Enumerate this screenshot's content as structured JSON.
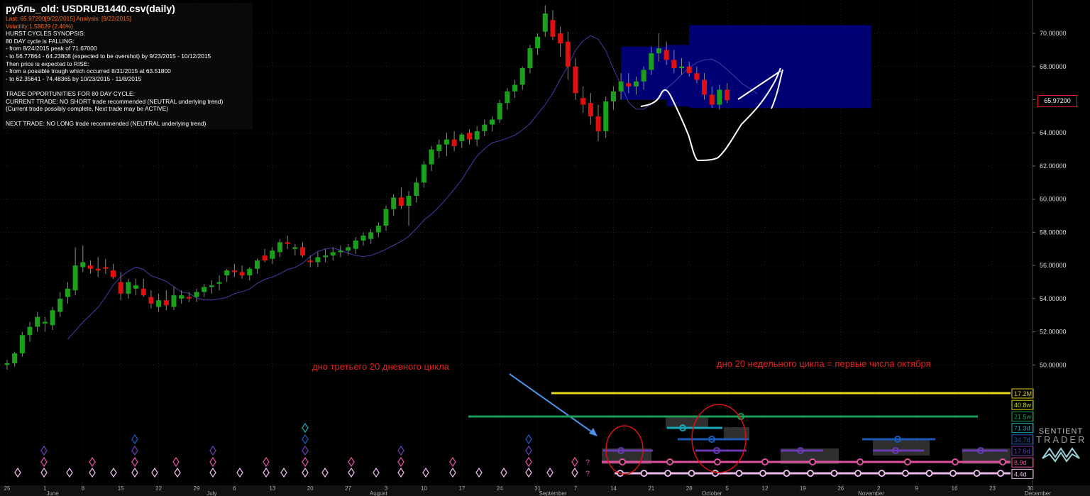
{
  "info": {
    "title": "рубль_old: USDRUB1440.csv(daily)",
    "last": "Last: 65.97200[9/22/2015] Analysis: [9/22/2015]",
    "volatility": "Volatility:1.58629 (2.40%)",
    "lines": [
      "HURST CYCLES SYNOPSIS:",
      "80 DAY cycle is FALLING:",
      "- from 8/24/2015 peak of 71.67000",
      "- to 56.77864 - 64.23808 (expected to be overshot) by 9/23/2015 - 10/12/2015",
      "Then price is expected to RISE:",
      "- from a possible trough which occurred 8/31/2015 at 63.51800",
      "- to 62.35641 - 74.48365 by 10/23/2015 - 11/8/2015",
      "",
      "TRADE OPPORTUNITIES FOR 80 DAY CYCLE:",
      "CURRENT TRADE: NO SHORT trade recommended (NEUTRAL underlying trend)",
      "(Current trade possibly complete, Next trade may be ACTIVE)",
      "",
      "NEXT TRADE: NO LONG trade recommended (NEUTRAL underlying trend)"
    ]
  },
  "current_price": "65.97200",
  "annotations": {
    "left": "дно третьего 20 дневного цикла",
    "right": "дно 20 недельного цикла = первые числа октября"
  },
  "logo": {
    "line1": "SENTIENT",
    "line2": "TRADER"
  },
  "colors": {
    "up": "#1aa01a",
    "down": "#e01010",
    "background": "#000000",
    "projection": "#00008a"
  },
  "chart_data": {
    "type": "candlestick",
    "y_ticks": [
      "50.00000",
      "52.00000",
      "54.00000",
      "56.00000",
      "58.00000",
      "60.00000",
      "62.00000",
      "64.00000",
      "66.00000",
      "68.00000",
      "70.00000"
    ],
    "ylim": [
      48.9,
      71.8
    ],
    "x_tick_labels": [
      {
        "day": 0,
        "label": "25"
      },
      {
        "day": 5,
        "label": "1"
      },
      {
        "day": 10,
        "label": "8"
      },
      {
        "day": 15,
        "label": "15"
      },
      {
        "day": 20,
        "label": "22"
      },
      {
        "day": 25,
        "label": "29"
      },
      {
        "day": 30,
        "label": "6"
      },
      {
        "day": 35,
        "label": "13"
      },
      {
        "day": 40,
        "label": "20"
      },
      {
        "day": 45,
        "label": "27"
      },
      {
        "day": 50,
        "label": "3"
      },
      {
        "day": 55,
        "label": "10"
      },
      {
        "day": 60,
        "label": "17"
      },
      {
        "day": 65,
        "label": "24"
      },
      {
        "day": 70,
        "label": "31"
      },
      {
        "day": 75,
        "label": "7"
      },
      {
        "day": 80,
        "label": "14"
      },
      {
        "day": 85,
        "label": "21"
      },
      {
        "day": 90,
        "label": "28"
      },
      {
        "day": 95,
        "label": "5"
      },
      {
        "day": 100,
        "label": "12"
      },
      {
        "day": 105,
        "label": "19"
      },
      {
        "day": 110,
        "label": "26"
      },
      {
        "day": 115,
        "label": "2"
      },
      {
        "day": 120,
        "label": "9"
      },
      {
        "day": 125,
        "label": "16"
      },
      {
        "day": 130,
        "label": "23"
      },
      {
        "day": 135,
        "label": "30"
      }
    ],
    "month_labels": [
      {
        "day": 6,
        "label": "June"
      },
      {
        "day": 27,
        "label": "July"
      },
      {
        "day": 49,
        "label": "August"
      },
      {
        "day": 72,
        "label": "September"
      },
      {
        "day": 93,
        "label": "October"
      },
      {
        "day": 114,
        "label": "November"
      },
      {
        "day": 136,
        "label": "December"
      }
    ],
    "candles": [
      [
        50.0,
        50.3,
        49.7,
        50.1
      ],
      [
        50.1,
        50.8,
        49.9,
        50.7
      ],
      [
        50.7,
        52.0,
        50.5,
        51.8
      ],
      [
        51.8,
        52.6,
        51.4,
        52.3
      ],
      [
        52.3,
        53.2,
        52.0,
        52.9
      ],
      [
        52.5,
        52.9,
        52.0,
        52.6
      ],
      [
        52.4,
        53.5,
        52.1,
        53.3
      ],
      [
        53.2,
        54.4,
        52.9,
        54.0
      ],
      [
        54.1,
        55.0,
        53.7,
        54.6
      ],
      [
        54.5,
        57.1,
        54.2,
        56.0
      ],
      [
        55.9,
        57.2,
        55.6,
        56.2
      ],
      [
        56.0,
        56.3,
        55.5,
        55.8
      ],
      [
        55.8,
        56.5,
        55.3,
        55.7
      ],
      [
        55.9,
        56.4,
        55.5,
        55.8
      ],
      [
        55.7,
        56.1,
        55.2,
        55.3
      ],
      [
        55.0,
        55.6,
        53.9,
        54.3
      ],
      [
        54.3,
        55.2,
        54.0,
        55.0
      ],
      [
        54.6,
        55.2,
        54.2,
        54.8
      ],
      [
        54.6,
        55.2,
        54.1,
        54.2
      ],
      [
        54.1,
        54.5,
        53.4,
        53.7
      ],
      [
        53.5,
        54.3,
        53.2,
        53.9
      ],
      [
        53.9,
        54.5,
        53.3,
        53.6
      ],
      [
        53.5,
        54.7,
        53.3,
        54.2
      ],
      [
        54.0,
        54.5,
        53.7,
        54.2
      ],
      [
        54.1,
        54.4,
        53.8,
        54.0
      ],
      [
        54.1,
        54.6,
        53.8,
        54.4
      ],
      [
        54.4,
        54.9,
        54.1,
        54.7
      ],
      [
        54.7,
        55.1,
        54.3,
        54.8
      ],
      [
        54.9,
        55.4,
        54.5,
        55.0
      ],
      [
        55.4,
        55.8,
        55.0,
        55.7
      ],
      [
        55.7,
        56.1,
        55.3,
        55.6
      ],
      [
        55.6,
        56.0,
        55.2,
        55.4
      ],
      [
        55.4,
        55.9,
        55.1,
        55.8
      ],
      [
        55.8,
        56.4,
        55.5,
        56.3
      ],
      [
        56.6,
        57.0,
        56.2,
        56.3
      ],
      [
        56.4,
        57.1,
        56.1,
        56.9
      ],
      [
        56.8,
        57.6,
        56.5,
        57.4
      ],
      [
        57.4,
        57.8,
        57.0,
        57.3
      ],
      [
        57.0,
        57.3,
        56.6,
        57.1
      ],
      [
        57.1,
        57.4,
        56.5,
        56.6
      ],
      [
        56.3,
        56.6,
        55.9,
        56.2
      ],
      [
        56.2,
        56.8,
        55.9,
        56.5
      ],
      [
        56.5,
        57.0,
        56.2,
        56.6
      ],
      [
        56.6,
        57.1,
        56.3,
        56.8
      ],
      [
        56.8,
        57.2,
        56.5,
        56.9
      ],
      [
        56.9,
        57.3,
        56.6,
        57.1
      ],
      [
        57.0,
        57.7,
        56.7,
        57.5
      ],
      [
        57.5,
        58.0,
        57.2,
        57.8
      ],
      [
        57.6,
        58.2,
        57.3,
        58.0
      ],
      [
        58.0,
        58.6,
        57.7,
        58.4
      ],
      [
        58.4,
        59.6,
        58.1,
        59.4
      ],
      [
        59.4,
        60.3,
        59.0,
        60.1
      ],
      [
        60.1,
        60.7,
        59.4,
        59.6
      ],
      [
        59.6,
        60.5,
        58.4,
        60.2
      ],
      [
        60.2,
        61.3,
        59.8,
        61.0
      ],
      [
        61.0,
        62.3,
        60.7,
        62.1
      ],
      [
        62.1,
        63.2,
        61.7,
        63.0
      ],
      [
        62.9,
        63.6,
        62.5,
        63.3
      ],
      [
        63.3,
        64.0,
        62.6,
        63.6
      ],
      [
        63.6,
        64.1,
        62.9,
        63.2
      ],
      [
        63.5,
        64.0,
        63.1,
        63.9
      ],
      [
        64.0,
        64.2,
        63.3,
        63.6
      ],
      [
        63.6,
        64.4,
        63.2,
        64.1
      ],
      [
        64.1,
        64.8,
        63.8,
        64.5
      ],
      [
        64.5,
        65.0,
        64.1,
        64.8
      ],
      [
        64.8,
        66.0,
        64.6,
        65.8
      ],
      [
        65.8,
        66.7,
        65.4,
        66.5
      ],
      [
        66.5,
        67.2,
        66.1,
        66.9
      ],
      [
        66.9,
        68.0,
        66.6,
        67.9
      ],
      [
        67.9,
        69.3,
        67.6,
        69.1
      ],
      [
        69.1,
        70.0,
        68.7,
        69.8
      ],
      [
        70.1,
        71.7,
        69.8,
        71.2
      ],
      [
        70.8,
        71.4,
        69.6,
        69.8
      ],
      [
        70.0,
        70.4,
        68.6,
        69.4
      ],
      [
        69.5,
        70.1,
        67.2,
        68.0
      ],
      [
        68.0,
        68.5,
        66.0,
        66.4
      ],
      [
        66.1,
        66.8,
        65.2,
        65.7
      ],
      [
        65.8,
        66.4,
        64.5,
        65.0
      ],
      [
        65.0,
        65.7,
        63.5,
        64.1
      ],
      [
        64.1,
        66.2,
        63.7,
        65.9
      ],
      [
        65.9,
        66.8,
        65.4,
        66.5
      ],
      [
        66.5,
        67.6,
        66.0,
        67.1
      ],
      [
        67.0,
        67.6,
        66.4,
        66.8
      ],
      [
        66.8,
        67.4,
        66.3,
        67.1
      ],
      [
        67.1,
        68.0,
        66.6,
        67.8
      ],
      [
        67.8,
        69.2,
        67.5,
        68.8
      ],
      [
        68.8,
        70.0,
        68.3,
        69.1
      ],
      [
        69.0,
        69.5,
        68.1,
        68.4
      ],
      [
        68.4,
        69.0,
        67.6,
        67.9
      ],
      [
        67.9,
        68.5,
        67.5,
        68.0
      ],
      [
        68.0,
        68.3,
        67.4,
        67.6
      ],
      [
        67.6,
        68.0,
        67.0,
        67.2
      ],
      [
        67.2,
        67.6,
        66.0,
        66.3
      ],
      [
        66.3,
        66.8,
        65.5,
        65.7
      ],
      [
        65.7,
        66.9,
        65.4,
        66.6
      ],
      [
        66.6,
        67.0,
        65.8,
        65.97
      ]
    ],
    "projection_boxes": [
      {
        "x0": 81,
        "x1": 87,
        "y0": 66.0,
        "y1": 69.2
      },
      {
        "x0": 87,
        "x1": 90,
        "y0": 65.6,
        "y1": 69.3
      },
      {
        "x0": 90,
        "x1": 114,
        "y0": 65.5,
        "y1": 70.5
      }
    ],
    "cycle_labels": [
      "17.2M",
      "40.8w",
      "21.5w",
      "71.3d",
      "34.7d",
      "17.5d",
      "8.9d",
      "4.4d"
    ],
    "cycle_colors": [
      "#e6d21a",
      "#c4d600",
      "#1a9e5a",
      "#1aa6b4",
      "#1a5ab4",
      "#6a3ab4",
      "#e0509e",
      "#e8b8e8"
    ]
  }
}
